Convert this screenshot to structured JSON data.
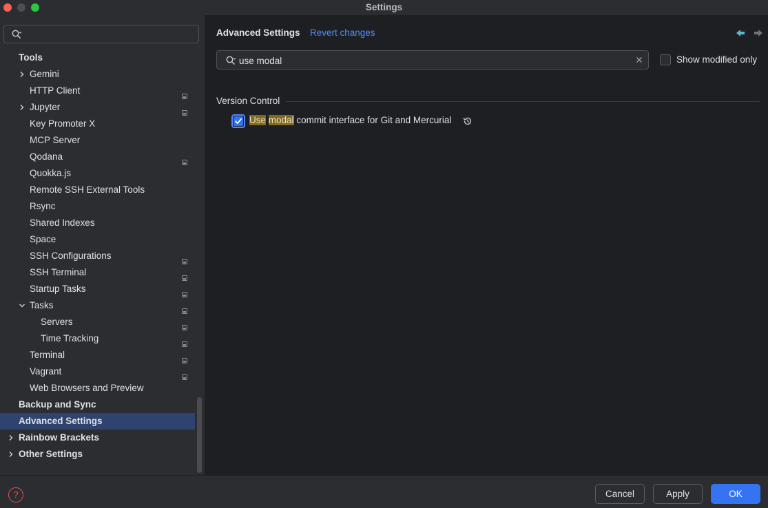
{
  "window": {
    "title": "Settings"
  },
  "sidebar": {
    "search_placeholder": "",
    "items": [
      {
        "label": "Tools",
        "bold": true,
        "level": 0,
        "chevron": "none",
        "project": false
      },
      {
        "label": "Gemini",
        "level": 1,
        "chevron": "right",
        "project": false
      },
      {
        "label": "HTTP Client",
        "level": 1,
        "chevron": "none",
        "project": true
      },
      {
        "label": "Jupyter",
        "level": 1,
        "chevron": "right",
        "project": true
      },
      {
        "label": "Key Promoter X",
        "level": 1,
        "chevron": "none",
        "project": false
      },
      {
        "label": "MCP Server",
        "level": 1,
        "chevron": "none",
        "project": false
      },
      {
        "label": "Qodana",
        "level": 1,
        "chevron": "none",
        "project": true
      },
      {
        "label": "Quokka.js",
        "level": 1,
        "chevron": "none",
        "project": false
      },
      {
        "label": "Remote SSH External Tools",
        "level": 1,
        "chevron": "none",
        "project": false
      },
      {
        "label": "Rsync",
        "level": 1,
        "chevron": "none",
        "project": false
      },
      {
        "label": "Shared Indexes",
        "level": 1,
        "chevron": "none",
        "project": false
      },
      {
        "label": "Space",
        "level": 1,
        "chevron": "none",
        "project": false
      },
      {
        "label": "SSH Configurations",
        "level": 1,
        "chevron": "none",
        "project": true
      },
      {
        "label": "SSH Terminal",
        "level": 1,
        "chevron": "none",
        "project": true
      },
      {
        "label": "Startup Tasks",
        "level": 1,
        "chevron": "none",
        "project": true
      },
      {
        "label": "Tasks",
        "level": 1,
        "chevron": "down",
        "project": true
      },
      {
        "label": "Servers",
        "level": 2,
        "chevron": "none",
        "project": true
      },
      {
        "label": "Time Tracking",
        "level": 2,
        "chevron": "none",
        "project": true
      },
      {
        "label": "Terminal",
        "level": 1,
        "chevron": "none",
        "project": true
      },
      {
        "label": "Vagrant",
        "level": 1,
        "chevron": "none",
        "project": true
      },
      {
        "label": "Web Browsers and Preview",
        "level": 1,
        "chevron": "none",
        "project": false
      },
      {
        "label": "Backup and Sync",
        "bold": true,
        "level": 0,
        "chevron": "none",
        "project": false
      },
      {
        "label": "Advanced Settings",
        "bold": true,
        "level": 0,
        "chevron": "none",
        "project": false,
        "selected": true
      },
      {
        "label": "Rainbow Brackets",
        "bold": true,
        "level": 0,
        "chevron": "right",
        "project": false
      },
      {
        "label": "Other Settings",
        "bold": true,
        "level": 0,
        "chevron": "right",
        "project": false
      }
    ]
  },
  "main": {
    "title": "Advanced Settings",
    "revert_label": "Revert changes",
    "search_value": "use modal",
    "show_modified_label": "Show modified only",
    "show_modified_checked": false,
    "section_title": "Version Control",
    "option": {
      "checked": true,
      "match_use": "Use",
      "match_modal": "modal",
      "rest": " commit interface for Git and Mercurial"
    }
  },
  "footer": {
    "help_symbol": "?",
    "cancel_label": "Cancel",
    "apply_label": "Apply",
    "ok_label": "OK"
  },
  "colors": {
    "background": "#1e1f22",
    "panel": "#2b2d30",
    "accent": "#3574f0",
    "link": "#548af7",
    "selection": "#2e436e",
    "highlight": "#816a20",
    "help": "#e55353"
  },
  "icons": {
    "sidebar_search": "search-icon",
    "main_search": "search-icon",
    "clear": "close-icon",
    "back": "arrow-left-icon",
    "forward": "arrow-right-icon",
    "reset": "reset-to-default-icon",
    "project": "project-level-icon"
  }
}
